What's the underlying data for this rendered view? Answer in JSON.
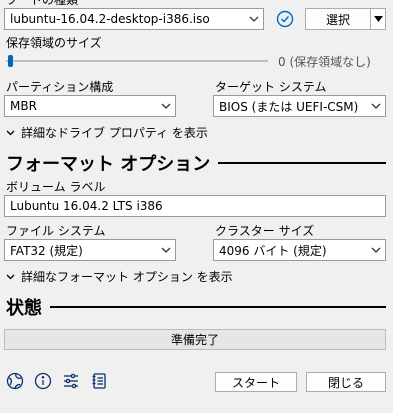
{
  "device_section": {
    "label": "ブートの種類",
    "image_value": "lubuntu-16.04.2-desktop-i386.iso",
    "select_button": "選択"
  },
  "persistence": {
    "label": "保存領域のサイズ",
    "value_text": "0 (保存領域なし)",
    "slider_value": 0
  },
  "partition": {
    "label": "パーティション構成",
    "value": "MBR"
  },
  "target_system": {
    "label": "ターゲット システム",
    "value": "BIOS (または UEFI-CSM)"
  },
  "advanced_drive_link": "詳細なドライブ プロパティ を表示",
  "format_options": {
    "title": "フォーマット オプション",
    "volume_label_label": "ボリューム ラベル",
    "volume_label_value": "Lubuntu 16.04.2 LTS i386",
    "filesystem_label": "ファイル システム",
    "filesystem_value": "FAT32 (規定)",
    "cluster_label": "クラスター サイズ",
    "cluster_value": "4096 バイト (規定)",
    "advanced_format_link": "詳細なフォーマット オプション を表示"
  },
  "status": {
    "title": "状態",
    "progress_text": "準備完了",
    "progress_fraction": 0
  },
  "footer": {
    "start_button": "スタート",
    "close_button": "閉じる"
  },
  "icons": {
    "globe": "globe-icon",
    "info": "info-icon",
    "settings": "settings-sliders-icon",
    "log": "log-icon",
    "check": "check-circle-icon"
  },
  "colors": {
    "accent": "#0067c0",
    "slider_thumb": "#0067c0",
    "progress_bg": "#e6e6e6"
  }
}
